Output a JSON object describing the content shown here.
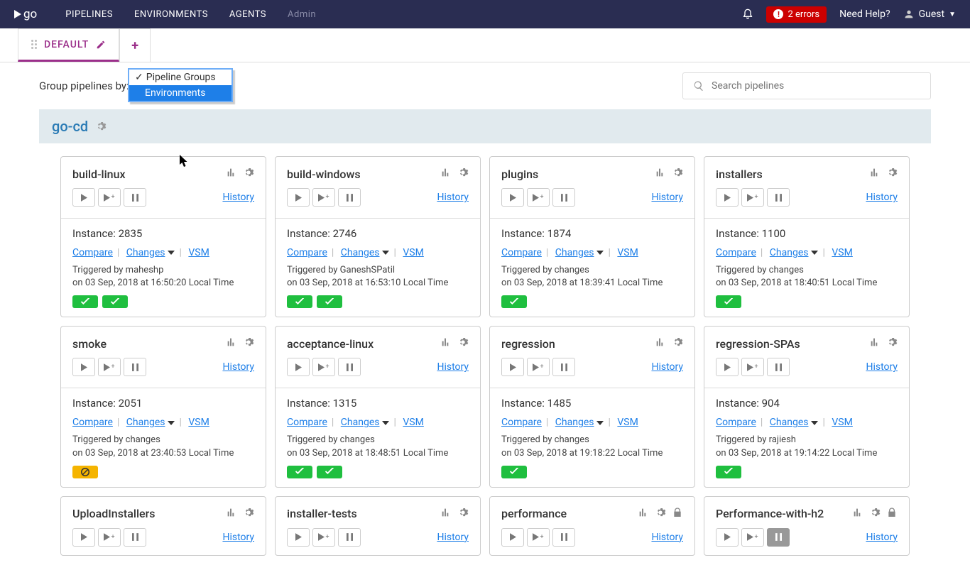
{
  "topbar": {
    "logo_text": "go",
    "nav": [
      "PIPELINES",
      "ENVIRONMENTS",
      "AGENTS",
      "Admin"
    ],
    "errors": "2 errors",
    "help": "Need Help?",
    "user": "Guest"
  },
  "tab_name": "DEFAULT",
  "filter_label": "Group pipelines by:",
  "dropdown_options": [
    "Pipeline Groups",
    "Environments"
  ],
  "search_placeholder": "Search pipelines",
  "group_name": "go-cd",
  "history_label": "History",
  "compare_label": "Compare",
  "changes_label": "Changes",
  "vsm_label": "VSM",
  "instance_label": "Instance:",
  "pipelines": [
    {
      "name": "build-linux",
      "instance": "2835",
      "trigger": "Triggered by maheshp",
      "time": "on 03 Sep, 2018 at 16:50:20 Local Time",
      "status": [
        "green",
        "green"
      ]
    },
    {
      "name": "build-windows",
      "instance": "2746",
      "trigger": "Triggered by GaneshSPatil",
      "time": "on 03 Sep, 2018 at 16:53:10 Local Time",
      "status": [
        "green",
        "green"
      ]
    },
    {
      "name": "plugins",
      "instance": "1874",
      "trigger": "Triggered by changes",
      "time": "on 03 Sep, 2018 at 18:39:41 Local Time",
      "status": [
        "green"
      ]
    },
    {
      "name": "installers",
      "instance": "1100",
      "trigger": "Triggered by changes",
      "time": "on 03 Sep, 2018 at 18:40:51 Local Time",
      "status": [
        "green"
      ]
    },
    {
      "name": "smoke",
      "instance": "2051",
      "trigger": "Triggered by changes",
      "time": "on 03 Sep, 2018 at 23:40:53 Local Time",
      "status": [
        "yellow"
      ]
    },
    {
      "name": "acceptance-linux",
      "instance": "1315",
      "trigger": "Triggered by changes",
      "time": "on 03 Sep, 2018 at 18:48:51 Local Time",
      "status": [
        "green",
        "green"
      ]
    },
    {
      "name": "regression",
      "instance": "1485",
      "trigger": "Triggered by changes",
      "time": "on 03 Sep, 2018 at 19:18:22 Local Time",
      "status": [
        "green"
      ]
    },
    {
      "name": "regression-SPAs",
      "instance": "904",
      "trigger": "Triggered by rajiesh",
      "time": "on 03 Sep, 2018 at 19:14:22 Local Time",
      "status": [
        "green"
      ]
    },
    {
      "name": "UploadInstallers",
      "instance": "",
      "trigger": "",
      "time": "",
      "status": []
    },
    {
      "name": "installer-tests",
      "instance": "",
      "trigger": "",
      "time": "",
      "status": []
    },
    {
      "name": "performance",
      "instance": "",
      "trigger": "",
      "time": "",
      "status": [],
      "lock": true
    },
    {
      "name": "Performance-with-h2",
      "instance": "",
      "trigger": "",
      "time": "",
      "status": [],
      "lock": true,
      "paused": true
    }
  ]
}
